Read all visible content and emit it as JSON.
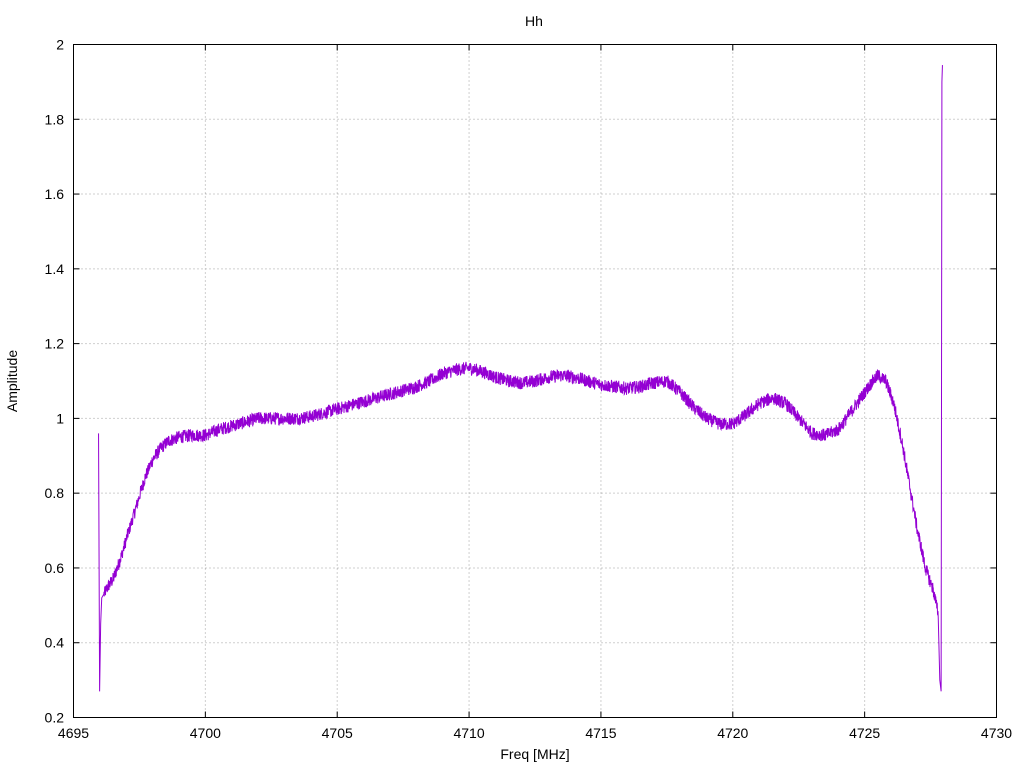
{
  "chart_data": {
    "type": "line",
    "title": "Hh",
    "xlabel": "Freq [MHz]",
    "ylabel": "Amplitude",
    "xlim": [
      4695,
      4730
    ],
    "ylim": [
      0.2,
      2
    ],
    "xticks": [
      4695,
      4700,
      4705,
      4710,
      4715,
      4720,
      4725,
      4730
    ],
    "yticks": [
      0.2,
      0.4,
      0.6,
      0.8,
      1,
      1.2,
      1.4,
      1.6,
      1.8,
      2
    ],
    "xtick_labels": [
      "4695",
      "4700",
      "4705",
      "4710",
      "4715",
      "4720",
      "4725",
      "4730"
    ],
    "ytick_labels": [
      "0.2",
      "0.4",
      "0.6",
      "0.8",
      "1",
      "1.2",
      "1.4",
      "1.6",
      "1.8",
      "2"
    ],
    "grid": true,
    "legend": "none",
    "series": [
      {
        "color": "#9400d3",
        "x": [
          4695.95,
          4695.99,
          4696.03,
          4696.07,
          4696.15,
          4696.3,
          4696.5,
          4696.8,
          4697.1,
          4697.4,
          4697.7,
          4698.0,
          4698.3,
          4698.6,
          4699.0,
          4699.5,
          4700.0,
          4700.5,
          4701.0,
          4701.5,
          4702.0,
          4702.5,
          4703.0,
          4703.5,
          4704.0,
          4704.5,
          4705.0,
          4705.5,
          4706.0,
          4706.5,
          4707.0,
          4707.5,
          4708.0,
          4708.5,
          4709.0,
          4709.5,
          4710.0,
          4710.5,
          4711.0,
          4711.5,
          4712.0,
          4712.5,
          4713.0,
          4713.5,
          4714.0,
          4714.5,
          4715.0,
          4715.5,
          4716.0,
          4716.5,
          4717.0,
          4717.5,
          4718.0,
          4718.5,
          4719.0,
          4719.5,
          4720.0,
          4720.5,
          4721.0,
          4721.5,
          4722.0,
          4722.5,
          4723.0,
          4723.5,
          4724.0,
          4724.5,
          4725.0,
          4725.3,
          4725.5,
          4725.8,
          4726.1,
          4726.4,
          4726.7,
          4727.0,
          4727.3,
          4727.6,
          4727.78,
          4727.85,
          4727.9,
          4727.93,
          4727.95
        ],
        "y": [
          0.96,
          0.27,
          0.45,
          0.52,
          0.53,
          0.55,
          0.57,
          0.63,
          0.7,
          0.77,
          0.84,
          0.89,
          0.92,
          0.94,
          0.95,
          0.955,
          0.955,
          0.97,
          0.98,
          0.99,
          1.0,
          1.0,
          1.0,
          1.0,
          1.005,
          1.015,
          1.025,
          1.035,
          1.045,
          1.055,
          1.065,
          1.075,
          1.085,
          1.1,
          1.12,
          1.13,
          1.135,
          1.125,
          1.11,
          1.1,
          1.095,
          1.1,
          1.11,
          1.115,
          1.11,
          1.1,
          1.09,
          1.085,
          1.08,
          1.085,
          1.095,
          1.1,
          1.07,
          1.03,
          1.0,
          0.985,
          0.985,
          1.01,
          1.04,
          1.055,
          1.04,
          1.0,
          0.96,
          0.955,
          0.97,
          1.02,
          1.07,
          1.1,
          1.115,
          1.1,
          1.04,
          0.94,
          0.82,
          0.7,
          0.6,
          0.54,
          0.48,
          0.3,
          0.27,
          1.9,
          1.945
        ]
      }
    ]
  }
}
